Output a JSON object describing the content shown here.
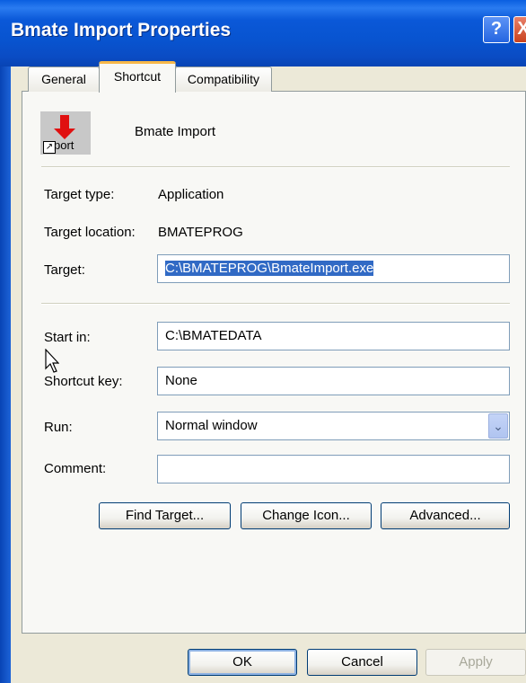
{
  "window": {
    "title": "Bmate Import Properties",
    "help_label": "?",
    "close_label": "X"
  },
  "tabs": [
    {
      "label": "General",
      "active": false
    },
    {
      "label": "Shortcut",
      "active": true
    },
    {
      "label": "Compatibility",
      "active": false
    }
  ],
  "shortcut": {
    "icon_text": "port",
    "icon_badge": "↗",
    "name": "Bmate Import",
    "target_type_label": "Target type:",
    "target_type_value": "Application",
    "target_location_label": "Target location:",
    "target_location_value": "BMATEPROG",
    "target_label": "Target:",
    "target_value": "C:\\BMATEPROG\\BmateImport.exe",
    "start_in_label": "Start in:",
    "start_in_value": "C:\\BMATEDATA",
    "shortcut_key_label": "Shortcut key:",
    "shortcut_key_value": "None",
    "run_label": "Run:",
    "run_value": "Normal window",
    "comment_label": "Comment:",
    "comment_value": ""
  },
  "actions": {
    "find_target": "Find Target...",
    "change_icon": "Change Icon...",
    "advanced": "Advanced..."
  },
  "footer": {
    "ok": "OK",
    "cancel": "Cancel",
    "apply": "Apply"
  },
  "colors": {
    "titlebar": "#0854d0",
    "selection": "#316ac5",
    "active_tab_accent": "#f7b84a"
  }
}
